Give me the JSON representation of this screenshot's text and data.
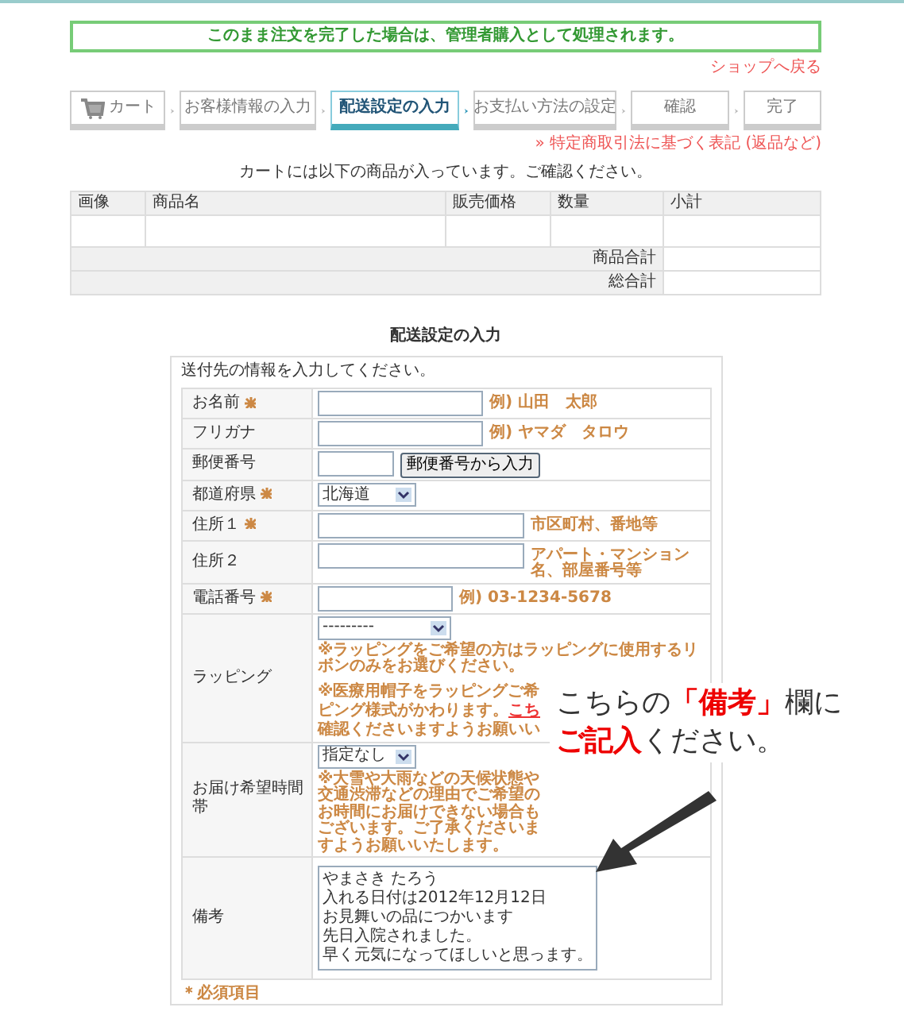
{
  "notice": "このまま注文を完了した場合は、管理者購入として処理されます。",
  "back_link": "ショップへ戻る",
  "steps": [
    {
      "label": "カート",
      "selected": false,
      "kind": "cart"
    },
    {
      "label": "お客様情報の入力",
      "selected": false,
      "kind": "plain"
    },
    {
      "label": "配送設定の入力",
      "selected": true,
      "kind": "plain"
    },
    {
      "label": "お支払い方法の設定",
      "selected": false,
      "kind": "plain"
    },
    {
      "label": "確認",
      "selected": false,
      "kind": "plain"
    },
    {
      "label": "完了",
      "selected": false,
      "kind": "plain"
    }
  ],
  "law_link": "» 特定商取引法に基づく表記 (返品など)",
  "cart_message": "カートには以下の商品が入っています。ご確認ください。",
  "cart_table": {
    "columns": [
      "画像",
      "商品名",
      "販売価格",
      "数量",
      "小計"
    ],
    "totals": [
      "商品合計",
      "総合計"
    ]
  },
  "section_title": "配送設定の入力",
  "form_intro": "送付先の情報を入力してください。",
  "fields": [
    {
      "label": "お名前",
      "required": true,
      "kind": "text",
      "hint": "例) 山田　太郎"
    },
    {
      "label": "フリガナ",
      "required": false,
      "kind": "text",
      "hint": "例) ヤマダ　タロウ"
    },
    {
      "label": "郵便番号",
      "required": false,
      "kind": "zip",
      "button": "郵便番号から入力"
    },
    {
      "label": "都道府県",
      "required": true,
      "kind": "select",
      "value": "北海道"
    },
    {
      "label": "住所１",
      "required": true,
      "kind": "long-text",
      "hint": "市区町村、番地等"
    },
    {
      "label": "住所２",
      "required": false,
      "kind": "long-text",
      "hint": "アパート・マンション名、部屋番号等"
    },
    {
      "label": "電話番号",
      "required": true,
      "kind": "short-text",
      "hint": "例) 03-1234-5678"
    },
    {
      "label": "ラッピング",
      "required": false,
      "kind": "select-wide",
      "value": "---------",
      "notes": [
        "※ラッピングをご希望の方はラッピングに使用するリボンのみをお選びください。"
      ],
      "notes_cut": [
        "※医療用帽子をラッピングご希",
        "ピング様式がかわります。",
        "確認くださいますようお願いい"
      ],
      "cut_link": "こち"
    },
    {
      "label": "お届け希望時間帯",
      "required": false,
      "kind": "select",
      "value": "指定なし",
      "notes": [
        "※大雪や大雨などの天候状態や交通渋滞などの理由でご希望のお時間にお届けできない場合もございます。ご了承くださいますようお願いいたします。"
      ]
    },
    {
      "label": "備考",
      "required": false,
      "kind": "textarea",
      "lines": [
        "やまさき たろう",
        "入れる日付は2012年12月12日",
        "お見舞いの品につかいます",
        "先日入院されました。",
        "早く元気になってほしいと思っます。"
      ]
    }
  ],
  "required_note": "＊必須項目",
  "callout": {
    "line1": [
      {
        "text": "こちらの",
        "emphasis": false
      },
      {
        "text": "「備考」",
        "emphasis": true
      },
      {
        "text": "欄に",
        "emphasis": false
      }
    ],
    "line2": [
      {
        "text": "ご記入",
        "emphasis": true
      },
      {
        "text": "ください。",
        "emphasis": false
      }
    ]
  }
}
